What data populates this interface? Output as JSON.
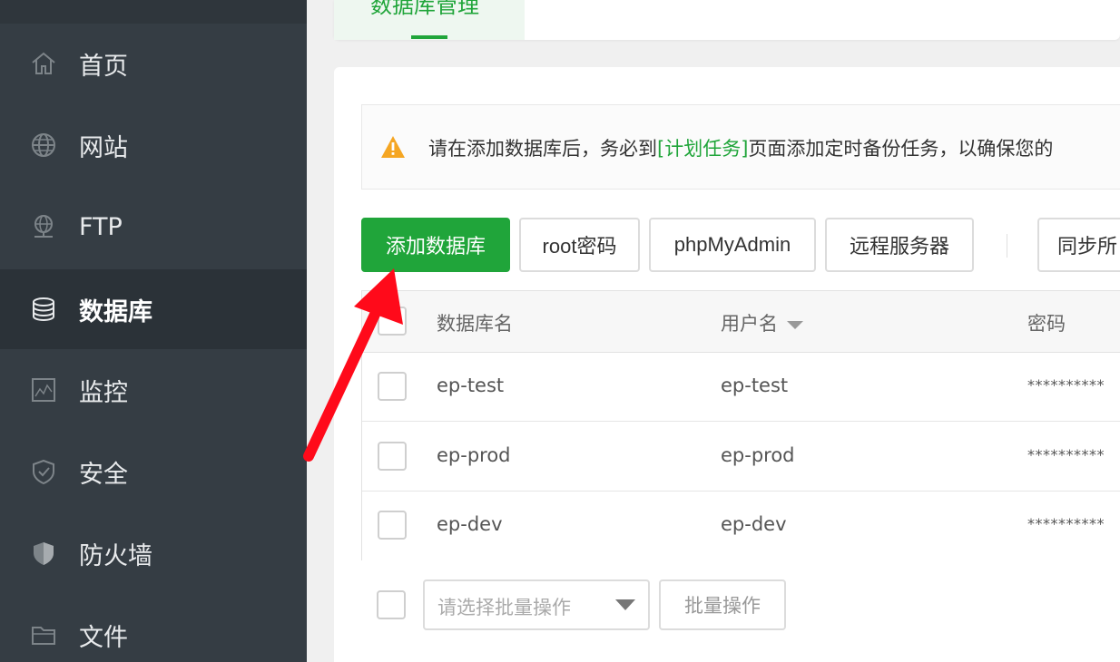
{
  "sidebar": {
    "items": [
      {
        "label": "首页",
        "icon": "home-icon"
      },
      {
        "label": "网站",
        "icon": "globe-icon"
      },
      {
        "label": "FTP",
        "icon": "ftp-icon"
      },
      {
        "label": "数据库",
        "icon": "database-icon",
        "active": true
      },
      {
        "label": "监控",
        "icon": "monitor-icon"
      },
      {
        "label": "安全",
        "icon": "shield-icon"
      },
      {
        "label": "防火墙",
        "icon": "firewall-icon"
      },
      {
        "label": "文件",
        "icon": "folder-icon"
      }
    ]
  },
  "tabs": {
    "active_label": "数据库管理"
  },
  "notice": {
    "prefix": "请在添加数据库后，务必到",
    "link": "[计划任务]",
    "suffix": "页面添加定时备份任务，以确保您的"
  },
  "toolbar": {
    "add_db": "添加数据库",
    "root_pwd": "root密码",
    "phpmyadmin": "phpMyAdmin",
    "remote_server": "远程服务器",
    "sync": "同步所"
  },
  "table": {
    "headers": {
      "name": "数据库名",
      "user": "用户名",
      "password": "密码"
    },
    "rows": [
      {
        "name": "ep-test",
        "user": "ep-test",
        "password": "**********"
      },
      {
        "name": "ep-prod",
        "user": "ep-prod",
        "password": "**********"
      },
      {
        "name": "ep-dev",
        "user": "ep-dev",
        "password": "**********"
      }
    ]
  },
  "batch": {
    "placeholder": "请选择批量操作",
    "button": "批量操作"
  },
  "colors": {
    "accent": "#20a53a",
    "sidebar_bg": "#353d44",
    "annotation_arrow": "#ff0a1a"
  }
}
